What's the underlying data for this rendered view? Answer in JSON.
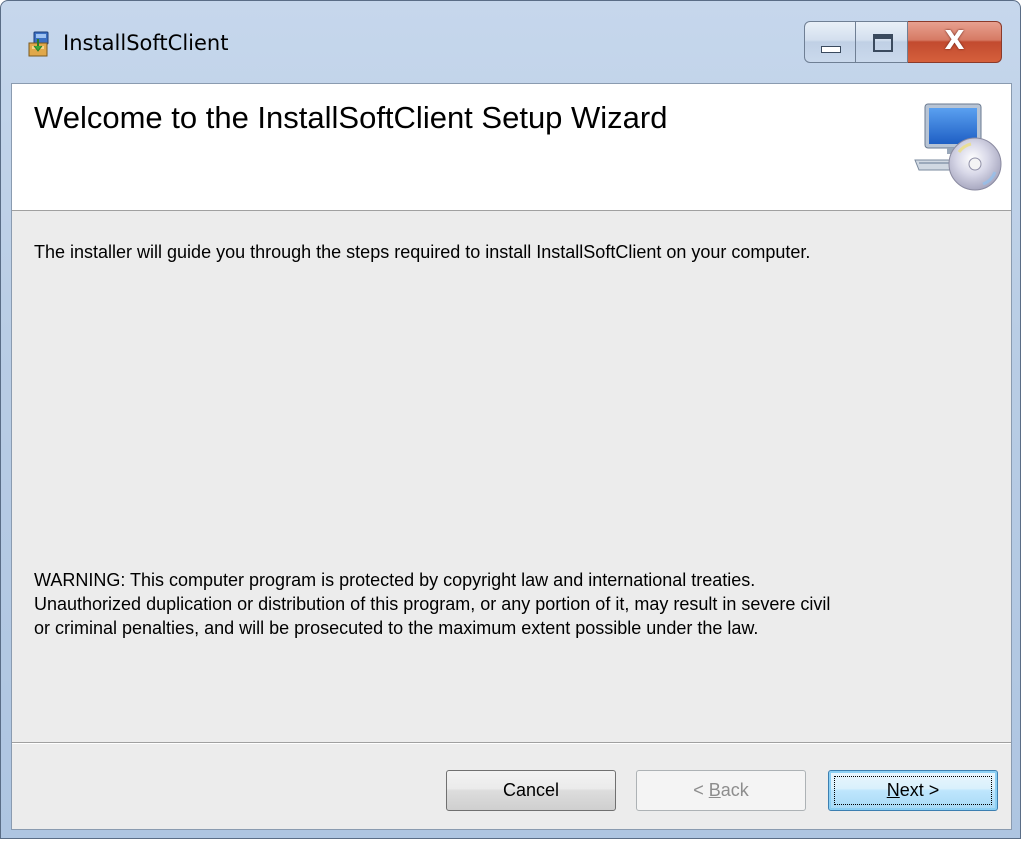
{
  "window": {
    "title": "InstallSoftClient",
    "app_icon": "installer-icon",
    "controls": {
      "minimize_icon": "minimize-icon",
      "maximize_icon": "maximize-icon",
      "close_label": "X"
    }
  },
  "banner": {
    "title": "Welcome to the InstallSoftClient Setup Wizard",
    "icon": "computer-cd-icon"
  },
  "body": {
    "intro": "The installer will guide you through the steps required to install InstallSoftClient on your computer.",
    "warning_lines": [
      "WARNING: This computer program is protected by copyright law and international treaties.",
      "Unauthorized duplication or distribution of this program, or any portion of it, may result in severe civil",
      "or criminal penalties, and will be prosecuted to the maximum extent possible under the law."
    ]
  },
  "buttons": {
    "cancel": "Cancel",
    "back_prefix": "< ",
    "back_accel": "B",
    "back_rest": "ack",
    "next_accel": "N",
    "next_rest": "ext >",
    "back_enabled": false
  },
  "colors": {
    "titlebar": "#b9cde5",
    "client_bg": "#ececec",
    "banner_bg": "#ffffff",
    "close_red": "#c24a2f"
  }
}
